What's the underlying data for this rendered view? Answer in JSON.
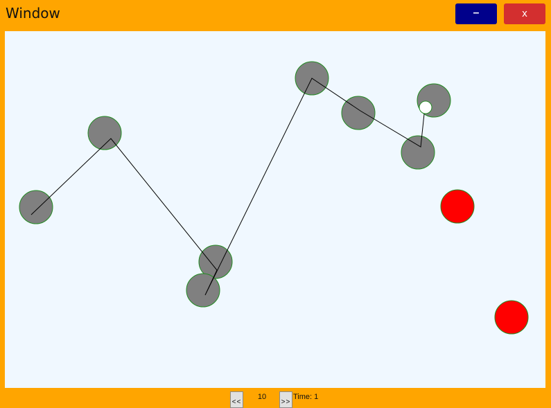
{
  "window": {
    "title": "Window",
    "minimize_label": "–",
    "close_label": "x"
  },
  "colors": {
    "frame": "#FFA500",
    "canvas": "#F0F8FF",
    "minimize_button": "#00008B",
    "close_button": "#D32F2F",
    "node_fill": "#808080",
    "node_stroke": "#228B22",
    "target_fill": "#FF0000",
    "path_line": "#000000",
    "current_marker": "#FFFFFF"
  },
  "scene": {
    "visited_nodes": 8,
    "target_nodes": 2
  },
  "footer": {
    "prev_label": "<<",
    "step_value": "10",
    "next_label": ">>",
    "time_label": "Time: 1"
  }
}
